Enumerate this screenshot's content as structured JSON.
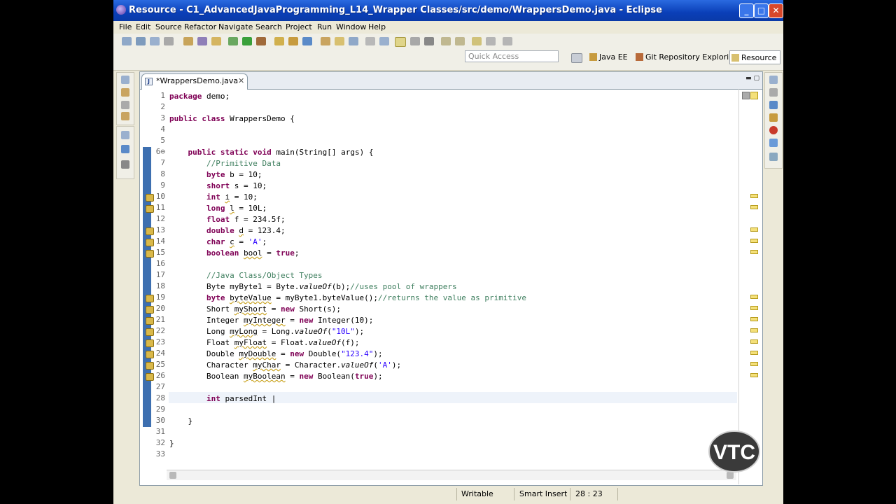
{
  "window": {
    "title": "Resource - C1_AdvancedJavaProgramming_L14_Wrapper Classes/src/demo/WrappersDemo.java - Eclipse",
    "controls": [
      "_",
      "□",
      "✕"
    ]
  },
  "menu": [
    "File",
    "Edit",
    "Source",
    "Refactor",
    "Navigate",
    "Search",
    "Project",
    "Run",
    "Window",
    "Help"
  ],
  "toolbar": {
    "quick_access_placeholder": "Quick Access",
    "perspectives": [
      {
        "label": "Java EE",
        "active": false
      },
      {
        "label": "Git Repository Exploring",
        "active": false
      },
      {
        "label": "Resource",
        "active": true
      }
    ]
  },
  "editor": {
    "tab_label": "*WrappersDemo.java",
    "tab_close": "✕",
    "line_numbers": [
      "1",
      "2",
      "3",
      "4",
      "5",
      "6⊖",
      "7",
      "8",
      "9",
      "10",
      "11",
      "12",
      "13",
      "14",
      "15",
      "16",
      "17",
      "18",
      "19",
      "20",
      "21",
      "22",
      "23",
      "24",
      "25",
      "26",
      "27",
      "28",
      "29",
      "30",
      "31",
      "32",
      "33"
    ],
    "code": [
      [
        {
          "t": "package",
          "k": "kw"
        },
        {
          "t": " demo;"
        }
      ],
      [],
      [
        {
          "t": "public",
          "k": "kw"
        },
        {
          "t": " "
        },
        {
          "t": "class",
          "k": "kw"
        },
        {
          "t": " WrappersDemo {"
        }
      ],
      [],
      [],
      [
        {
          "t": "    "
        },
        {
          "t": "public",
          "k": "kw"
        },
        {
          "t": " "
        },
        {
          "t": "static",
          "k": "kw"
        },
        {
          "t": " "
        },
        {
          "t": "void",
          "k": "kw"
        },
        {
          "t": " main(String[] args) {"
        }
      ],
      [
        {
          "t": "        "
        },
        {
          "t": "//Primitive Data",
          "k": "cm"
        }
      ],
      [
        {
          "t": "        "
        },
        {
          "t": "byte",
          "k": "kw"
        },
        {
          "t": " b = 10;"
        }
      ],
      [
        {
          "t": "        "
        },
        {
          "t": "short",
          "k": "kw"
        },
        {
          "t": " s = 10;"
        }
      ],
      [
        {
          "t": "        "
        },
        {
          "t": "int",
          "k": "kw"
        },
        {
          "t": " "
        },
        {
          "t": "i",
          "k": "sq"
        },
        {
          "t": " = 10;"
        }
      ],
      [
        {
          "t": "        "
        },
        {
          "t": "long",
          "k": "kw"
        },
        {
          "t": " "
        },
        {
          "t": "l",
          "k": "sq"
        },
        {
          "t": " = 10L;"
        }
      ],
      [
        {
          "t": "        "
        },
        {
          "t": "float",
          "k": "kw"
        },
        {
          "t": " f = 234.5f;"
        }
      ],
      [
        {
          "t": "        "
        },
        {
          "t": "double",
          "k": "kw"
        },
        {
          "t": " "
        },
        {
          "t": "d",
          "k": "sq"
        },
        {
          "t": " = 123.4;"
        }
      ],
      [
        {
          "t": "        "
        },
        {
          "t": "char",
          "k": "kw"
        },
        {
          "t": " "
        },
        {
          "t": "c",
          "k": "sq"
        },
        {
          "t": " = "
        },
        {
          "t": "'A'",
          "k": "st"
        },
        {
          "t": ";"
        }
      ],
      [
        {
          "t": "        "
        },
        {
          "t": "boolean",
          "k": "kw"
        },
        {
          "t": " "
        },
        {
          "t": "bool",
          "k": "sq"
        },
        {
          "t": " = "
        },
        {
          "t": "true",
          "k": "kw"
        },
        {
          "t": ";"
        }
      ],
      [],
      [
        {
          "t": "        "
        },
        {
          "t": "//Java Class/Object Types",
          "k": "cm"
        }
      ],
      [
        {
          "t": "        Byte myByte1 = Byte."
        },
        {
          "t": "valueOf",
          "k": "it"
        },
        {
          "t": "(b);"
        },
        {
          "t": "//uses pool of wrappers",
          "k": "cm"
        }
      ],
      [
        {
          "t": "        "
        },
        {
          "t": "byte",
          "k": "kw"
        },
        {
          "t": " "
        },
        {
          "t": "byteValue",
          "k": "sq"
        },
        {
          "t": " = myByte1.byteValue();"
        },
        {
          "t": "//returns the value as primitive",
          "k": "cm"
        }
      ],
      [
        {
          "t": "        Short "
        },
        {
          "t": "myShort",
          "k": "sq"
        },
        {
          "t": " = "
        },
        {
          "t": "new",
          "k": "kw"
        },
        {
          "t": " Short(s);"
        }
      ],
      [
        {
          "t": "        Integer "
        },
        {
          "t": "myInteger",
          "k": "sq"
        },
        {
          "t": " = "
        },
        {
          "t": "new",
          "k": "kw"
        },
        {
          "t": " Integer(10);"
        }
      ],
      [
        {
          "t": "        Long "
        },
        {
          "t": "myLong",
          "k": "sq"
        },
        {
          "t": " = Long."
        },
        {
          "t": "valueOf",
          "k": "it"
        },
        {
          "t": "("
        },
        {
          "t": "\"10L\"",
          "k": "st"
        },
        {
          "t": ");"
        }
      ],
      [
        {
          "t": "        Float "
        },
        {
          "t": "myFloat",
          "k": "sq"
        },
        {
          "t": " = Float."
        },
        {
          "t": "valueOf",
          "k": "it"
        },
        {
          "t": "(f);"
        }
      ],
      [
        {
          "t": "        Double "
        },
        {
          "t": "myDouble",
          "k": "sq"
        },
        {
          "t": " = "
        },
        {
          "t": "new",
          "k": "kw"
        },
        {
          "t": " Double("
        },
        {
          "t": "\"123.4\"",
          "k": "st"
        },
        {
          "t": ");"
        }
      ],
      [
        {
          "t": "        Character "
        },
        {
          "t": "myChar",
          "k": "sq"
        },
        {
          "t": " = Character."
        },
        {
          "t": "valueOf",
          "k": "it"
        },
        {
          "t": "("
        },
        {
          "t": "'A'",
          "k": "st"
        },
        {
          "t": ");"
        }
      ],
      [
        {
          "t": "        Boolean "
        },
        {
          "t": "myBoolean",
          "k": "sq"
        },
        {
          "t": " = "
        },
        {
          "t": "new",
          "k": "kw"
        },
        {
          "t": " Boolean("
        },
        {
          "t": "true",
          "k": "kw"
        },
        {
          "t": ");"
        }
      ],
      [],
      [
        {
          "t": "        "
        },
        {
          "t": "int",
          "k": "kw"
        },
        {
          "t": " parsedInt |"
        }
      ],
      [],
      [
        {
          "t": "    }"
        }
      ],
      [],
      [
        {
          "t": "}"
        }
      ],
      []
    ]
  },
  "status": {
    "mode": "Writable",
    "insert": "Smart Insert",
    "position": "28 : 23"
  },
  "watermark": "VTC"
}
